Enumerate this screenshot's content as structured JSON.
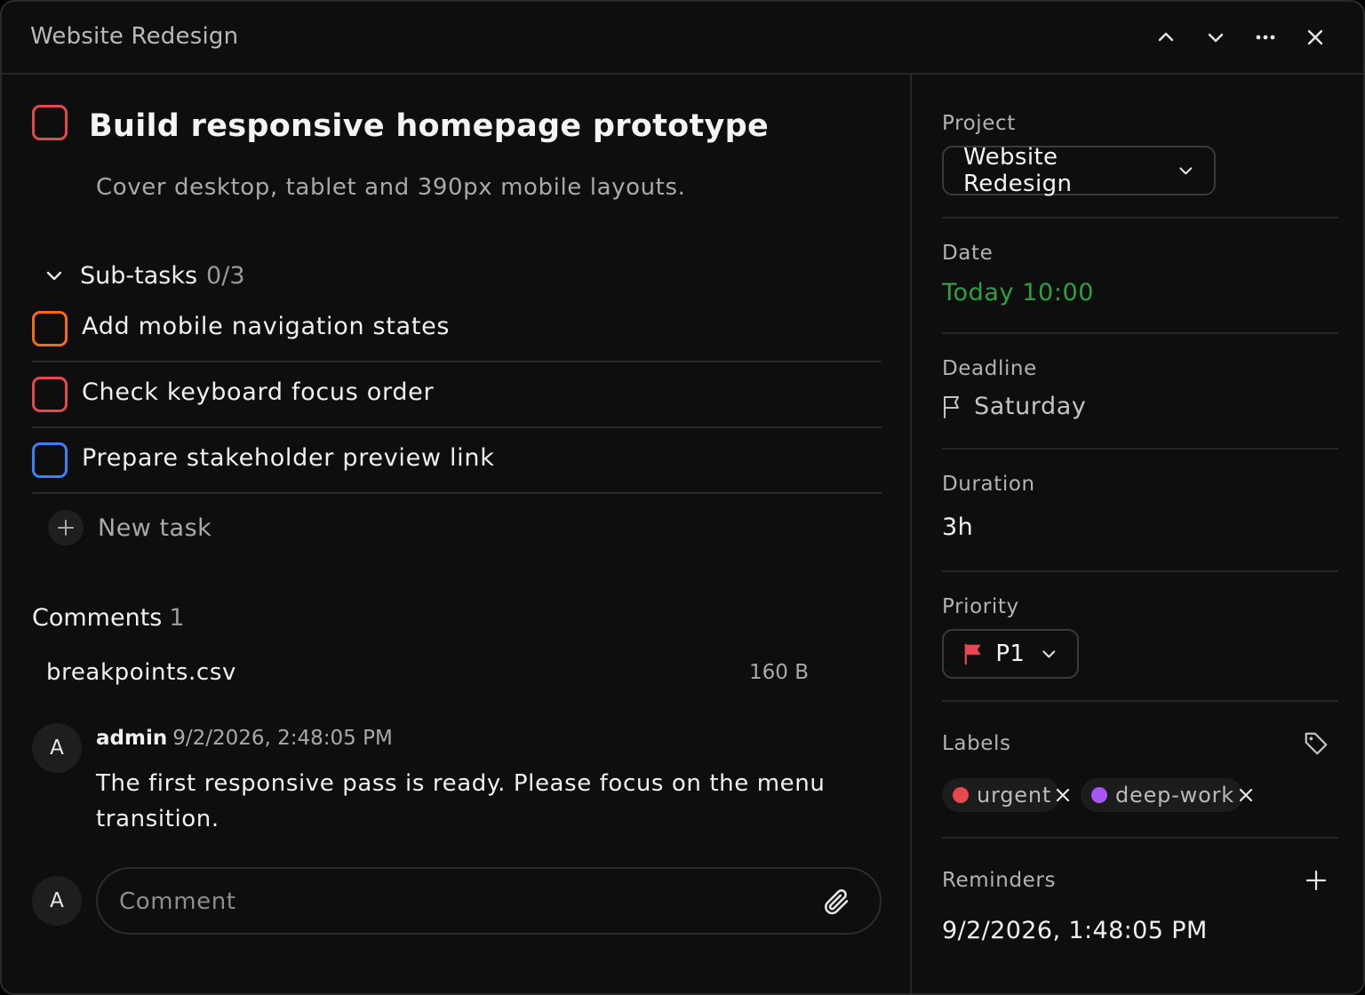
{
  "header": {
    "title": "Website Redesign",
    "icons": [
      "chevron-up-icon",
      "chevron-down-icon",
      "more-icon",
      "close-icon"
    ]
  },
  "task": {
    "title": "Build responsive homepage prototype",
    "description": "Cover desktop, tablet and 390px mobile layouts.",
    "checkbox_color": "#e5484d"
  },
  "subtasks": {
    "label": "Sub-tasks",
    "count": "0/3",
    "items": [
      {
        "label": "Add mobile navigation states",
        "color": "#f76b15"
      },
      {
        "label": "Check keyboard focus order",
        "color": "#e5484d"
      },
      {
        "label": "Prepare stakeholder preview link",
        "color": "#3b82f6"
      }
    ],
    "new_task_label": "New task"
  },
  "comments": {
    "label": "Comments",
    "count": "1",
    "attachment": {
      "name": "breakpoints.csv",
      "size": "160 B"
    },
    "items": [
      {
        "avatar": "A",
        "author": "admin",
        "time": "9/2/2026, 2:48:05 PM",
        "body": "The first responsive pass is ready. Please focus on the menu transition."
      }
    ],
    "input": {
      "avatar": "A",
      "placeholder": "Comment"
    }
  },
  "sidebar": {
    "project": {
      "label": "Project",
      "value": "Website Redesign"
    },
    "date": {
      "label": "Date",
      "value": "Today 10:00",
      "color": "#2ea043"
    },
    "deadline": {
      "label": "Deadline",
      "value": "Saturday"
    },
    "duration": {
      "label": "Duration",
      "value": "3h"
    },
    "priority": {
      "label": "Priority",
      "value": "P1",
      "flag_color": "#e5484d"
    },
    "labels": {
      "label": "Labels",
      "items": [
        {
          "name": "urgent",
          "color": "#e5484d"
        },
        {
          "name": "deep-work",
          "color": "#a855f7"
        }
      ]
    },
    "reminders": {
      "label": "Reminders",
      "value": "9/2/2026, 1:48:05 PM"
    }
  }
}
